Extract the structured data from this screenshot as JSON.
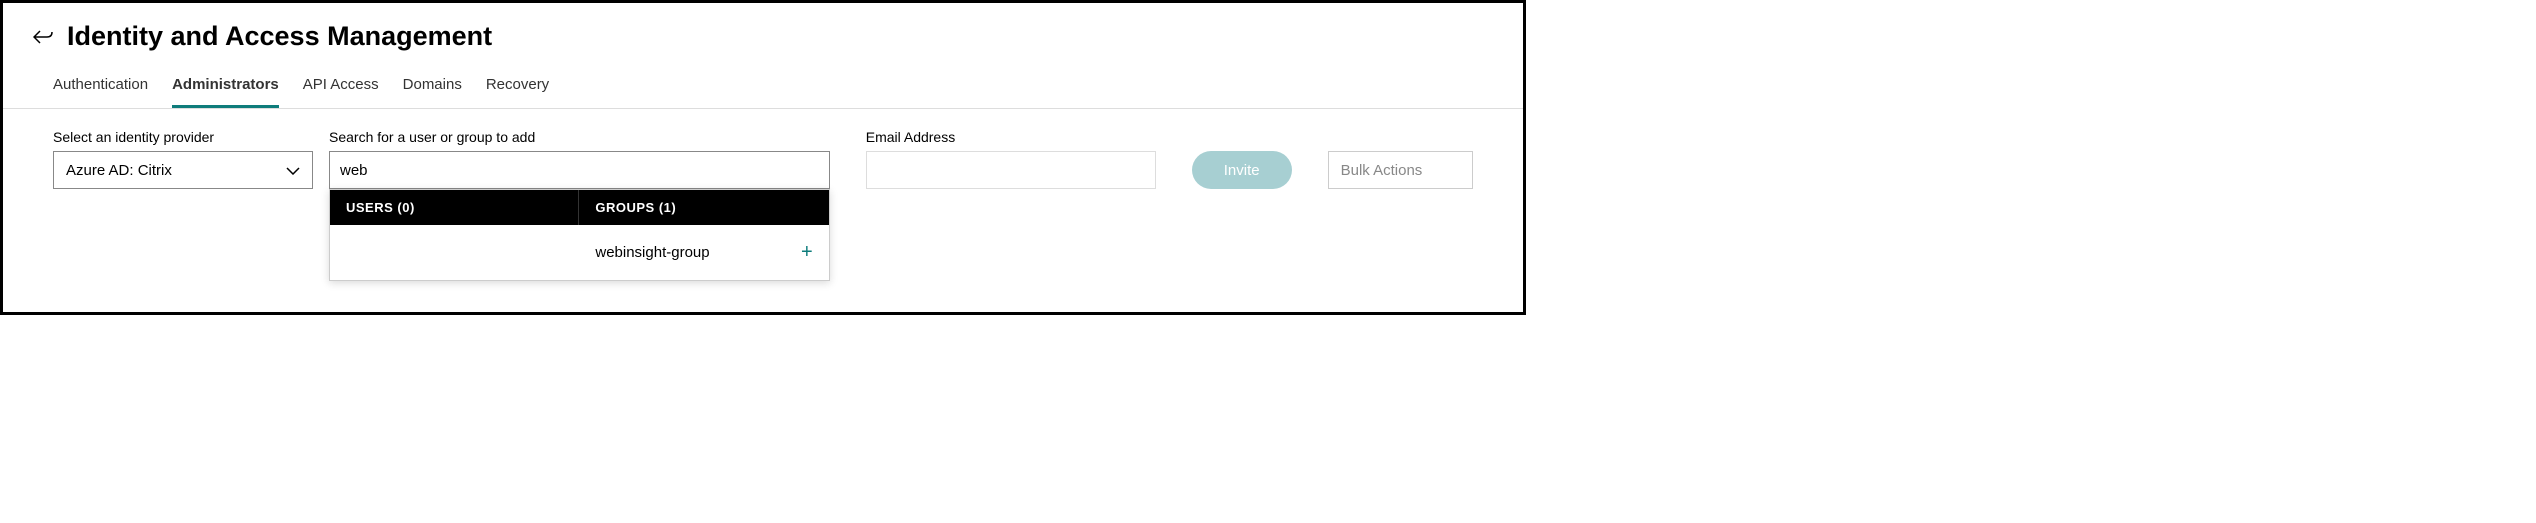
{
  "header": {
    "title": "Identity and Access Management"
  },
  "tabs": [
    {
      "label": "Authentication",
      "active": false
    },
    {
      "label": "Administrators",
      "active": true
    },
    {
      "label": "API Access",
      "active": false
    },
    {
      "label": "Domains",
      "active": false
    },
    {
      "label": "Recovery",
      "active": false
    }
  ],
  "fields": {
    "idp_label": "Select an identity provider",
    "idp_value": "Azure AD: Citrix",
    "search_label": "Search for a user or group to add",
    "search_value": "web",
    "email_label": "Email Address",
    "email_value": "",
    "invite_label": "Invite",
    "bulk_label": "Bulk Actions"
  },
  "dropdown": {
    "users_header": "USERS (0)",
    "groups_header": "GROUPS (1)",
    "group_item": "webinsight-group"
  }
}
